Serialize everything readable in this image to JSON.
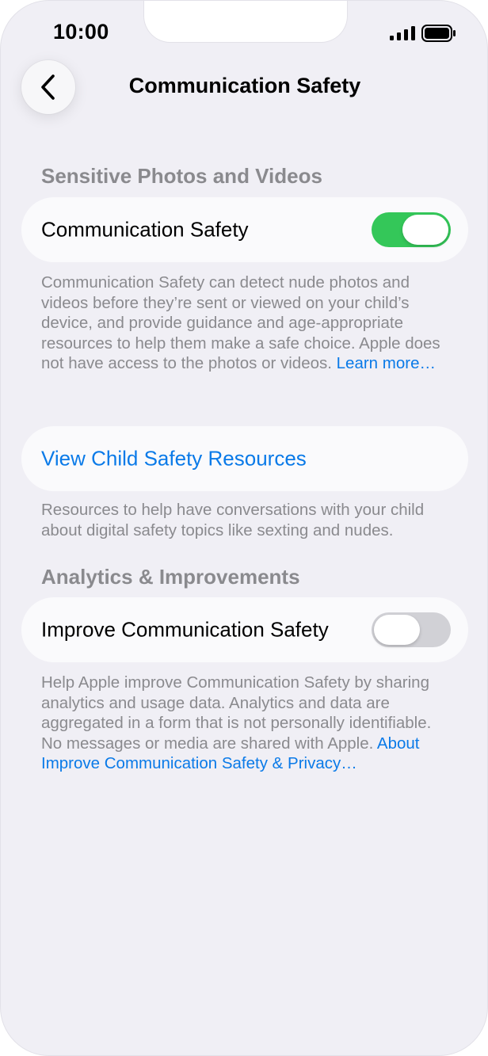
{
  "status_bar": {
    "time": "10:00"
  },
  "nav": {
    "title": "Communication Safety"
  },
  "section1": {
    "header": "Sensitive Photos and Videos",
    "row_label": "Communication Safety",
    "toggle_on": true,
    "footer_text": "Communication Safety can detect nude photos and videos before they’re sent or viewed on your child’s device, and provide guidance and age-appropriate resources to help them make a safe choice. Apple does not have access to the photos or videos. ",
    "footer_link": "Learn more…"
  },
  "resources": {
    "link_label": "View Child Safety Resources",
    "footer_text": "Resources to help have conversations with your child about digital safety topics like sexting and nudes."
  },
  "section2": {
    "header": "Analytics & Improvements",
    "row_label": "Improve Communication Safety",
    "toggle_on": false,
    "footer_text": "Help Apple improve Communication Safety by sharing analytics and usage data. Analytics and data are aggregated in a form that is not personally identifiable. No messages or media are shared with Apple. ",
    "footer_link": "About Improve Communication Safety & Privacy…"
  },
  "colors": {
    "accent": "#0a7ae8",
    "toggle_on": "#34c759",
    "toggle_off": "#d1d1d6",
    "background": "#f0eff5",
    "secondary_text": "#8a8a8e"
  },
  "icons": {
    "back": "chevron-left-icon",
    "signal": "cellular-signal-icon",
    "battery": "battery-icon"
  }
}
